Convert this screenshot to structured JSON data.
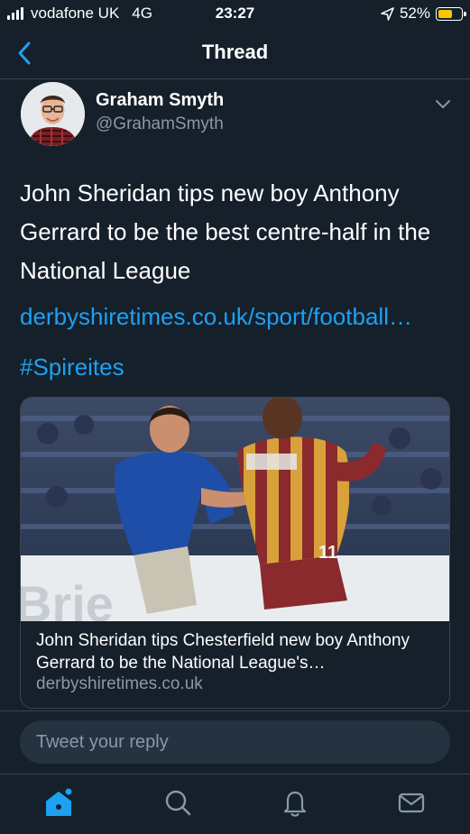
{
  "status_bar": {
    "carrier": "vodafone UK",
    "network": "4G",
    "time": "23:27",
    "battery_percent": "52%",
    "battery_level": 0.52,
    "icons": [
      "signal-bars-icon",
      "location-arrow-icon",
      "battery-icon"
    ]
  },
  "nav": {
    "title": "Thread",
    "back_icon": "chevron-left-icon"
  },
  "tweet": {
    "author_name": "Graham Smyth",
    "author_handle": "@GrahamSmyth",
    "text": "John Sheridan tips new boy Anthony Gerrard to be the best centre-half in the National League",
    "link": "derbyshiretimes.co.uk/sport/football…",
    "hashtag": "#Spireites",
    "card": {
      "title": "John Sheridan tips Chesterfield new boy Anthony Gerrard to be the National League's…",
      "domain": "derbyshiretimes.co.uk",
      "image_text": "Brie"
    }
  },
  "reply": {
    "placeholder": "Tweet your reply"
  },
  "tab_bar": {
    "tabs": [
      "home-icon",
      "search-icon",
      "notifications-icon",
      "messages-icon"
    ]
  },
  "colors": {
    "background": "#15202b",
    "accent": "#1da1f2",
    "secondary_text": "#8899a6",
    "divider": "#38444d",
    "battery": "#f7c600"
  }
}
